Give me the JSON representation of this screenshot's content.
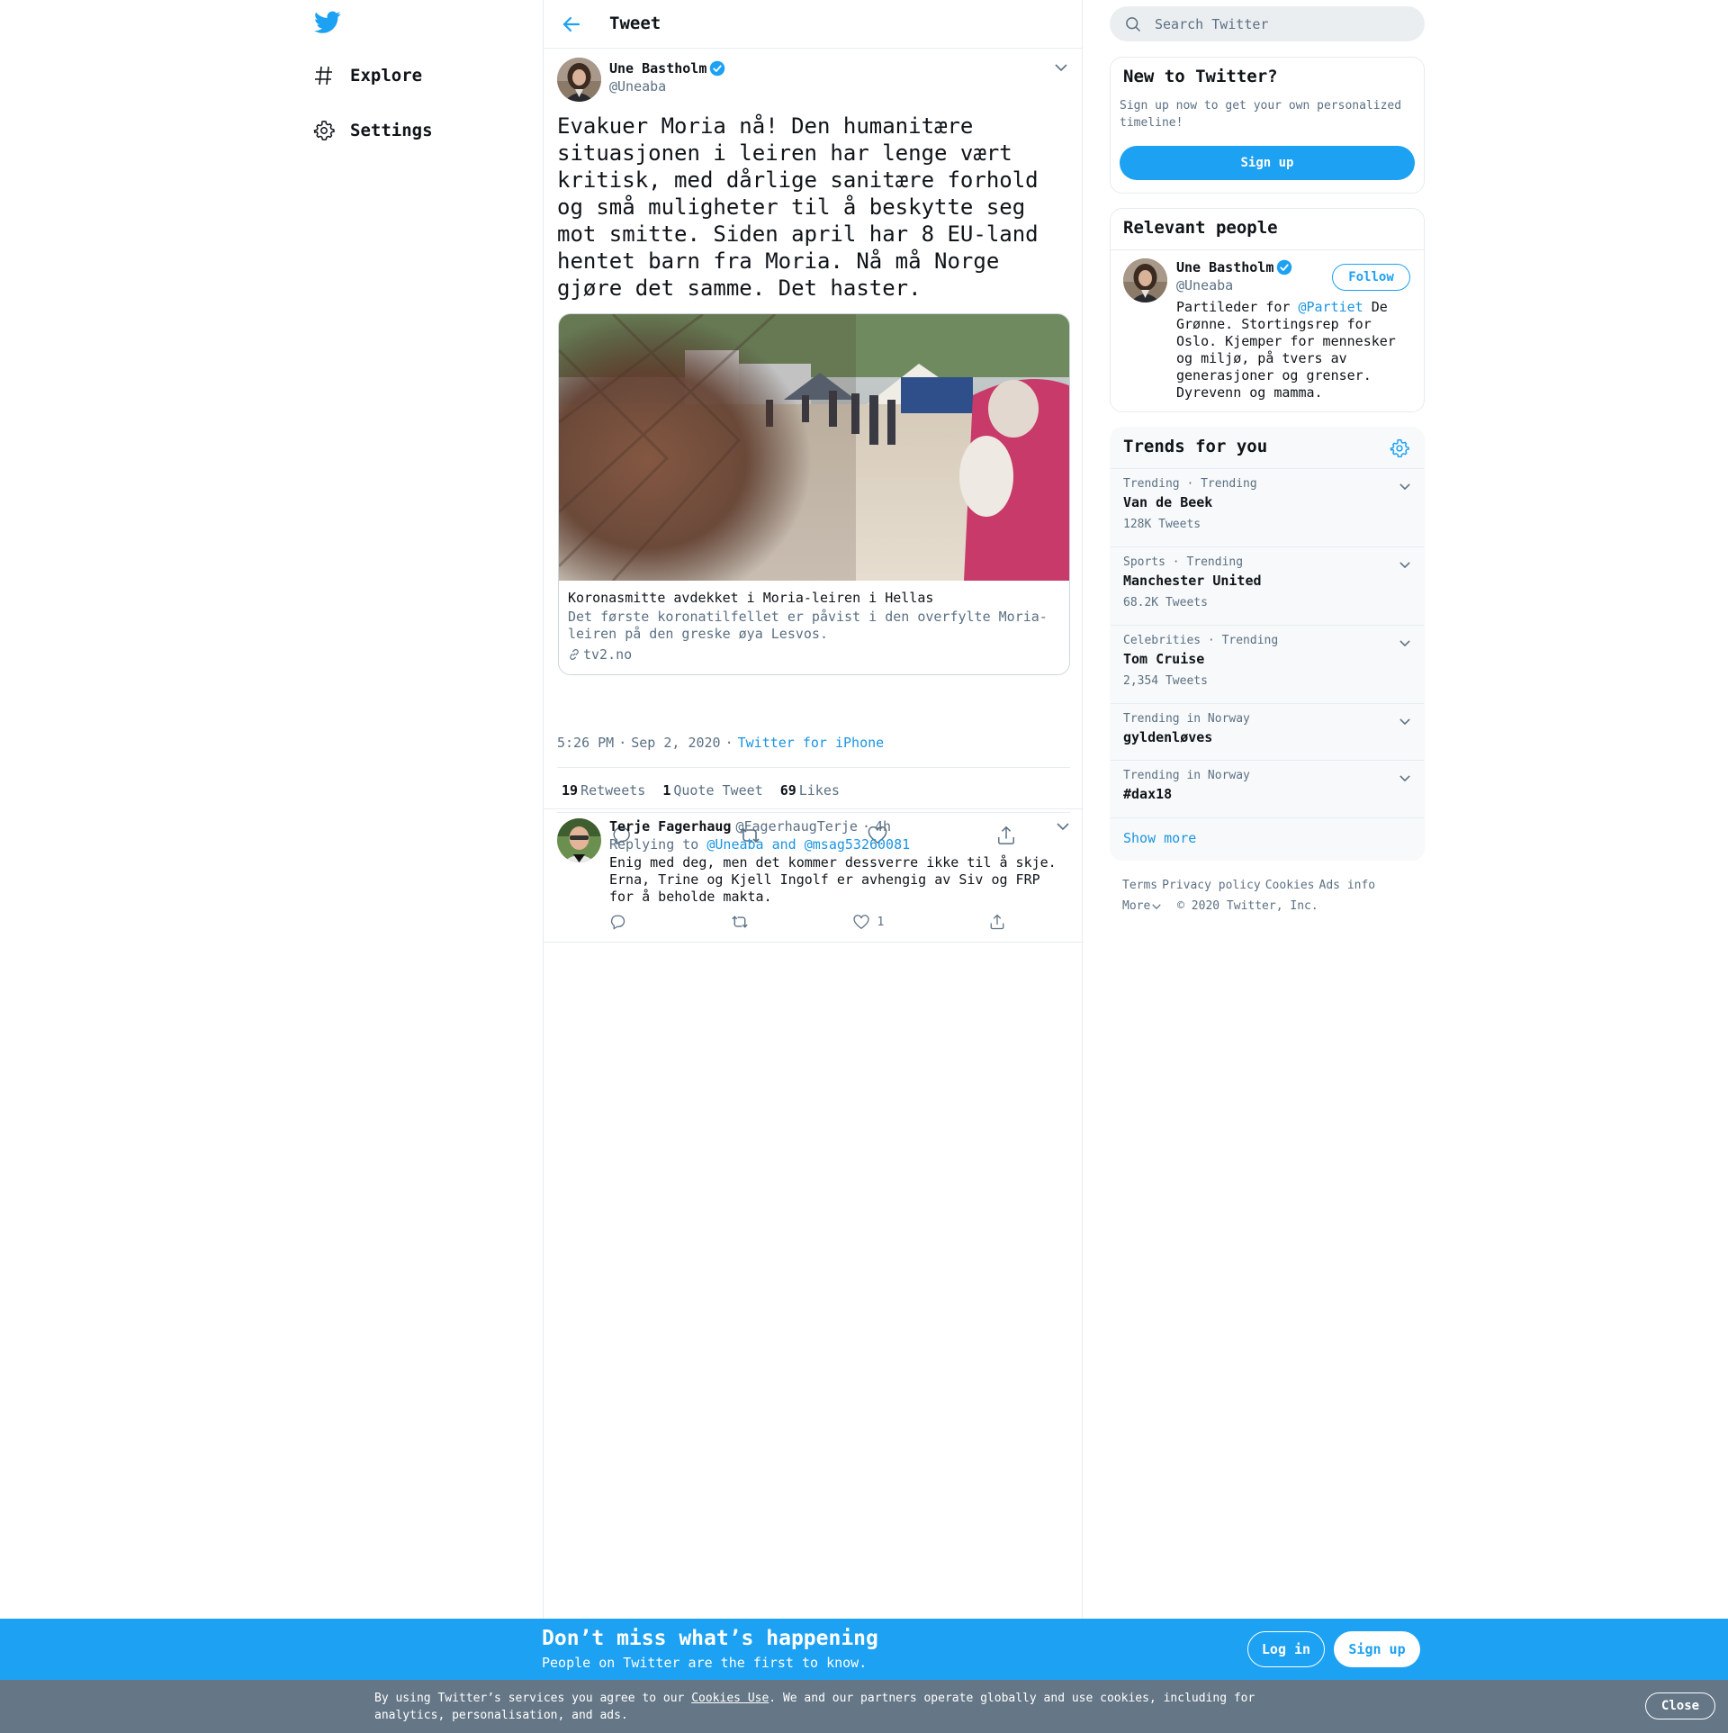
{
  "colors": {
    "brand": "#1da1f2",
    "link": "#1b95e0",
    "muted": "#5b7083",
    "text": "#0f1419",
    "border": "#e6ecf0"
  },
  "nav": {
    "logo_icon": "twitter-bird-icon",
    "items": [
      {
        "label": "Explore",
        "icon": "hashtag-icon"
      },
      {
        "label": "Settings",
        "icon": "gear-icon"
      }
    ]
  },
  "header": {
    "title": "Tweet",
    "back_icon": "arrow-left-icon"
  },
  "tweet": {
    "author_name": "Une Bastholm",
    "author_handle": "@Uneaba",
    "verified": true,
    "text": "Evakuer Moria nå! Den humanitære situasjonen i leiren har lenge vært kritisk, med dårlige sanitære forhold og små muligheter til å beskytte seg mot smitte. Siden april har 8 EU-land hentet barn fra Moria. Nå må Norge gjøre det samme. Det haster.",
    "card": {
      "title": "Koronasmitte avdekket i Moria-leiren i Hellas",
      "description": "Det første koronatilfellet er påvist i den overfylte Moria-leiren på den greske øya Lesvos.",
      "domain": "tv2.no"
    },
    "time": "5:26 PM",
    "dot": "·",
    "date": "Sep 2, 2020",
    "source": "Twitter for iPhone",
    "stats": {
      "retweets_count": "19",
      "retweets_label": "Retweets",
      "quotes_count": "1",
      "quotes_label": "Quote Tweet",
      "likes_count": "69",
      "likes_label": "Likes"
    }
  },
  "reply": {
    "author_name": "Terje Fagerhaug",
    "author_handle": "@FagerhaugTerje",
    "dot": "·",
    "time": "4h",
    "replying_prefix": "Replying to",
    "replying_to": "@Uneaba and @msag53260081",
    "text": "Enig med deg, men det kommer dessverre ikke til å skje. Erna, Trine og Kjell Ingolf er avhengig av Siv og FRP for å beholde makta.",
    "like_count": "1"
  },
  "search": {
    "placeholder": "Search Twitter"
  },
  "new_to_twitter": {
    "title": "New to Twitter?",
    "description": "Sign up now to get your own personalized timeline!",
    "button": "Sign up"
  },
  "relevant_people": {
    "title": "Relevant people",
    "name": "Une Bastholm",
    "handle": "@Uneaba",
    "follow_label": "Follow",
    "bio_prefix": "Partileder for ",
    "bio_mention": "@Partiet",
    "bio_suffix": " De Grønne. Stortingsrep for Oslo. Kjemper for mennesker og miljø, på tvers av generasjoner og grenser. Dyrevenn og mamma."
  },
  "trends": {
    "title": "Trends for you",
    "items": [
      {
        "context": "Trending · Trending",
        "name": "Van de Beek",
        "count": "128K Tweets"
      },
      {
        "context": "Sports · Trending",
        "name": "Manchester United",
        "count": "68.2K Tweets"
      },
      {
        "context": "Celebrities · Trending",
        "name": "Tom Cruise",
        "count": "2,354 Tweets"
      },
      {
        "context": "Trending in Norway",
        "name": "gyldenløves",
        "count": ""
      },
      {
        "context": "Trending in Norway",
        "name": "#dax18",
        "count": ""
      }
    ],
    "show_more": "Show more"
  },
  "footer": {
    "links": [
      "Terms",
      "Privacy policy",
      "Cookies",
      "Ads info"
    ],
    "more": "More",
    "copyright": "© 2020 Twitter, Inc."
  },
  "bottom_bar": {
    "title": "Don’t miss what’s happening",
    "subtitle": "People on Twitter are the first to know.",
    "login": "Log in",
    "signup": "Sign up"
  },
  "cookie_bar": {
    "text_before": "By using Twitter’s services you agree to our ",
    "link": "Cookies Use",
    "text_after": ". We and our partners operate globally and use cookies, including for analytics, personalisation, and ads.",
    "close": "Close"
  }
}
